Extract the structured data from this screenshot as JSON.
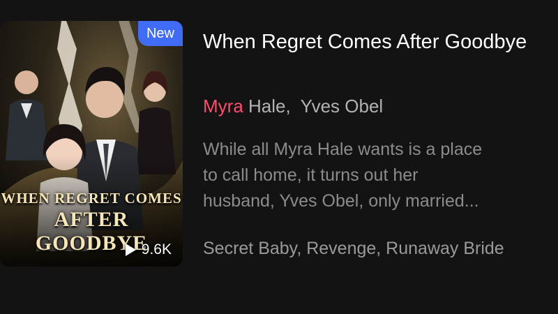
{
  "book": {
    "badge": "New",
    "cover_title_line1": "When Regret Comes",
    "cover_title_line2": "After Goodbye",
    "views": "9.6K",
    "title": "When Regret Comes After Goodbye",
    "authors": {
      "highlight": "Myra",
      "rest": " Hale,  Yves Obel"
    },
    "description_lines": [
      "While all Myra Hale wants is a place",
      "to call home, it turns out her",
      "husband, Yves Obel, only married..."
    ],
    "tags": "Secret Baby, Revenge, Runaway Bride"
  },
  "colors": {
    "background": "#131313",
    "badge": "#3f6cf2",
    "author_highlight": "#ff4d6d"
  },
  "icons": {
    "views": "play-icon"
  }
}
